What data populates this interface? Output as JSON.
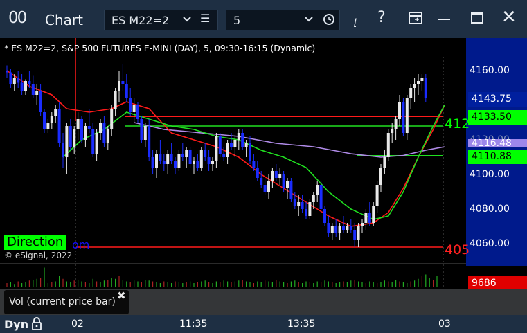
{
  "app": {
    "icon": "00",
    "title": "Chart"
  },
  "toolbar": {
    "symbol": "ES M22=2",
    "interval": "5",
    "icons": [
      "chevron-down-icon",
      "menu-icon",
      "clock-icon",
      "draw-icon",
      "help-icon",
      "export-icon",
      "restore-icon",
      "maximize-icon",
      "close-icon"
    ]
  },
  "chart": {
    "header": "* ES M22=2, S&P 500 FUTURES E-MINI (DAY), 5, 09:30-16:15 (Dynamic)",
    "direction_label": "Direction",
    "direction_tail": "om",
    "copyright": "© eSignal, 2022",
    "green_level_label": "412",
    "red_level_label": "405"
  },
  "price_axis": {
    "ticks": [
      "4160.00",
      "4120.00",
      "4100.00",
      "4080.00",
      "4060.00"
    ],
    "badges": {
      "last": "4143.75",
      "green_upper": "4133.50",
      "purple": "4116.48",
      "green_lower": "4110.88",
      "volume": "9686"
    }
  },
  "volume_panel": {
    "study_label": "Vol (current price bar)"
  },
  "time_axis": {
    "mode": "Dyn",
    "labels": [
      "02",
      "11:35",
      "13:35",
      "03"
    ]
  },
  "colors": {
    "bull": "#e8e8e8",
    "bear": "#1a2cff",
    "red_ma": "#ff1a1a",
    "green_ma": "#20e020",
    "purple_ma": "#b08be8",
    "price_axis_bg": "#001a8c",
    "badge_last": "#001f9e",
    "badge_green": "#00ff00",
    "badge_purple": "#9d87ea",
    "badge_volume": "#e00000"
  },
  "chart_data": {
    "type": "candlestick",
    "y_ticks": [
      4160,
      4140,
      4120,
      4100,
      4080,
      4060
    ],
    "candles": [
      {
        "o": 4160,
        "h": 4163,
        "l": 4156,
        "c": 4159
      },
      {
        "o": 4159,
        "h": 4161,
        "l": 4150,
        "c": 4152
      },
      {
        "o": 4152,
        "h": 4158,
        "l": 4148,
        "c": 4156
      },
      {
        "o": 4156,
        "h": 4160,
        "l": 4150,
        "c": 4153
      },
      {
        "o": 4153,
        "h": 4158,
        "l": 4146,
        "c": 4148
      },
      {
        "o": 4148,
        "h": 4155,
        "l": 4146,
        "c": 4154
      },
      {
        "o": 4154,
        "h": 4160,
        "l": 4150,
        "c": 4152
      },
      {
        "o": 4152,
        "h": 4157,
        "l": 4144,
        "c": 4146
      },
      {
        "o": 4146,
        "h": 4152,
        "l": 4140,
        "c": 4148
      },
      {
        "o": 4148,
        "h": 4152,
        "l": 4134,
        "c": 4136
      },
      {
        "o": 4136,
        "h": 4138,
        "l": 4124,
        "c": 4126
      },
      {
        "o": 4126,
        "h": 4132,
        "l": 4124,
        "c": 4130
      },
      {
        "o": 4130,
        "h": 4136,
        "l": 4126,
        "c": 4134
      },
      {
        "o": 4134,
        "h": 4140,
        "l": 4130,
        "c": 4138
      },
      {
        "o": 4138,
        "h": 4142,
        "l": 4116,
        "c": 4118
      },
      {
        "o": 4118,
        "h": 4124,
        "l": 4104,
        "c": 4110
      },
      {
        "o": 4110,
        "h": 4130,
        "l": 4100,
        "c": 4128
      },
      {
        "o": 4128,
        "h": 4132,
        "l": 4114,
        "c": 4116
      },
      {
        "o": 4116,
        "h": 4128,
        "l": 4112,
        "c": 4126
      },
      {
        "o": 4126,
        "h": 4136,
        "l": 4120,
        "c": 4132
      },
      {
        "o": 4132,
        "h": 4134,
        "l": 4118,
        "c": 4120
      },
      {
        "o": 4120,
        "h": 4130,
        "l": 4116,
        "c": 4128
      },
      {
        "o": 4128,
        "h": 4138,
        "l": 4124,
        "c": 4126
      },
      {
        "o": 4126,
        "h": 4130,
        "l": 4110,
        "c": 4112
      },
      {
        "o": 4112,
        "h": 4126,
        "l": 4108,
        "c": 4124
      },
      {
        "o": 4124,
        "h": 4132,
        "l": 4120,
        "c": 4130
      },
      {
        "o": 4130,
        "h": 4134,
        "l": 4116,
        "c": 4118
      },
      {
        "o": 4118,
        "h": 4128,
        "l": 4114,
        "c": 4126
      },
      {
        "o": 4126,
        "h": 4140,
        "l": 4122,
        "c": 4138
      },
      {
        "o": 4138,
        "h": 4150,
        "l": 4134,
        "c": 4148
      },
      {
        "o": 4148,
        "h": 4160,
        "l": 4142,
        "c": 4154
      },
      {
        "o": 4154,
        "h": 4164,
        "l": 4148,
        "c": 4152
      },
      {
        "o": 4152,
        "h": 4158,
        "l": 4142,
        "c": 4144
      },
      {
        "o": 4144,
        "h": 4150,
        "l": 4134,
        "c": 4136
      },
      {
        "o": 4136,
        "h": 4144,
        "l": 4130,
        "c": 4140
      },
      {
        "o": 4140,
        "h": 4142,
        "l": 4130,
        "c": 4132
      },
      {
        "o": 4132,
        "h": 4134,
        "l": 4118,
        "c": 4120
      },
      {
        "o": 4120,
        "h": 4130,
        "l": 4116,
        "c": 4128
      },
      {
        "o": 4128,
        "h": 4132,
        "l": 4108,
        "c": 4110
      },
      {
        "o": 4110,
        "h": 4114,
        "l": 4100,
        "c": 4104
      },
      {
        "o": 4104,
        "h": 4114,
        "l": 4098,
        "c": 4112
      },
      {
        "o": 4112,
        "h": 4120,
        "l": 4106,
        "c": 4108
      },
      {
        "o": 4108,
        "h": 4112,
        "l": 4102,
        "c": 4106
      },
      {
        "o": 4106,
        "h": 4114,
        "l": 4100,
        "c": 4112
      },
      {
        "o": 4112,
        "h": 4118,
        "l": 4106,
        "c": 4108
      },
      {
        "o": 4108,
        "h": 4110,
        "l": 4100,
        "c": 4104
      },
      {
        "o": 4104,
        "h": 4114,
        "l": 4102,
        "c": 4112
      },
      {
        "o": 4112,
        "h": 4118,
        "l": 4108,
        "c": 4110
      },
      {
        "o": 4110,
        "h": 4116,
        "l": 4104,
        "c": 4114
      },
      {
        "o": 4114,
        "h": 4116,
        "l": 4104,
        "c": 4106
      },
      {
        "o": 4106,
        "h": 4110,
        "l": 4100,
        "c": 4108
      },
      {
        "o": 4108,
        "h": 4112,
        "l": 4102,
        "c": 4104
      },
      {
        "o": 4104,
        "h": 4116,
        "l": 4102,
        "c": 4114
      },
      {
        "o": 4114,
        "h": 4118,
        "l": 4108,
        "c": 4110
      },
      {
        "o": 4110,
        "h": 4114,
        "l": 4102,
        "c": 4106
      },
      {
        "o": 4106,
        "h": 4110,
        "l": 4102,
        "c": 4108
      },
      {
        "o": 4108,
        "h": 4124,
        "l": 4104,
        "c": 4122
      },
      {
        "o": 4122,
        "h": 4124,
        "l": 4110,
        "c": 4112
      },
      {
        "o": 4112,
        "h": 4116,
        "l": 4108,
        "c": 4110
      },
      {
        "o": 4110,
        "h": 4120,
        "l": 4106,
        "c": 4118
      },
      {
        "o": 4118,
        "h": 4124,
        "l": 4114,
        "c": 4116
      },
      {
        "o": 4116,
        "h": 4122,
        "l": 4110,
        "c": 4120
      },
      {
        "o": 4120,
        "h": 4126,
        "l": 4114,
        "c": 4124
      },
      {
        "o": 4124,
        "h": 4126,
        "l": 4114,
        "c": 4116
      },
      {
        "o": 4116,
        "h": 4120,
        "l": 4110,
        "c": 4118
      },
      {
        "o": 4118,
        "h": 4122,
        "l": 4106,
        "c": 4108
      },
      {
        "o": 4108,
        "h": 4112,
        "l": 4102,
        "c": 4104
      },
      {
        "o": 4104,
        "h": 4108,
        "l": 4096,
        "c": 4098
      },
      {
        "o": 4098,
        "h": 4102,
        "l": 4092,
        "c": 4094
      },
      {
        "o": 4094,
        "h": 4098,
        "l": 4088,
        "c": 4090
      },
      {
        "o": 4090,
        "h": 4100,
        "l": 4086,
        "c": 4096
      },
      {
        "o": 4096,
        "h": 4104,
        "l": 4092,
        "c": 4102
      },
      {
        "o": 4102,
        "h": 4106,
        "l": 4096,
        "c": 4098
      },
      {
        "o": 4098,
        "h": 4104,
        "l": 4094,
        "c": 4100
      },
      {
        "o": 4100,
        "h": 4102,
        "l": 4090,
        "c": 4092
      },
      {
        "o": 4092,
        "h": 4098,
        "l": 4086,
        "c": 4096
      },
      {
        "o": 4096,
        "h": 4098,
        "l": 4084,
        "c": 4086
      },
      {
        "o": 4086,
        "h": 4090,
        "l": 4080,
        "c": 4082
      },
      {
        "o": 4082,
        "h": 4088,
        "l": 4076,
        "c": 4084
      },
      {
        "o": 4084,
        "h": 4088,
        "l": 4078,
        "c": 4080
      },
      {
        "o": 4080,
        "h": 4084,
        "l": 4074,
        "c": 4076
      },
      {
        "o": 4076,
        "h": 4086,
        "l": 4074,
        "c": 4084
      },
      {
        "o": 4084,
        "h": 4090,
        "l": 4080,
        "c": 4088
      },
      {
        "o": 4088,
        "h": 4096,
        "l": 4084,
        "c": 4094
      },
      {
        "o": 4094,
        "h": 4096,
        "l": 4078,
        "c": 4080
      },
      {
        "o": 4080,
        "h": 4082,
        "l": 4070,
        "c": 4072
      },
      {
        "o": 4072,
        "h": 4076,
        "l": 4064,
        "c": 4066
      },
      {
        "o": 4066,
        "h": 4072,
        "l": 4062,
        "c": 4070
      },
      {
        "o": 4070,
        "h": 4074,
        "l": 4064,
        "c": 4066
      },
      {
        "o": 4066,
        "h": 4072,
        "l": 4062,
        "c": 4070
      },
      {
        "o": 4070,
        "h": 4076,
        "l": 4066,
        "c": 4068
      },
      {
        "o": 4068,
        "h": 4072,
        "l": 4066,
        "c": 4070
      },
      {
        "o": 4070,
        "h": 4074,
        "l": 4066,
        "c": 4068
      },
      {
        "o": 4068,
        "h": 4072,
        "l": 4058,
        "c": 4062
      },
      {
        "o": 4062,
        "h": 4072,
        "l": 4058,
        "c": 4070
      },
      {
        "o": 4070,
        "h": 4074,
        "l": 4066,
        "c": 4072
      },
      {
        "o": 4072,
        "h": 4080,
        "l": 4068,
        "c": 4078
      },
      {
        "o": 4078,
        "h": 4084,
        "l": 4070,
        "c": 4072
      },
      {
        "o": 4072,
        "h": 4084,
        "l": 4070,
        "c": 4082
      },
      {
        "o": 4082,
        "h": 4096,
        "l": 4078,
        "c": 4094
      },
      {
        "o": 4094,
        "h": 4106,
        "l": 4090,
        "c": 4104
      },
      {
        "o": 4104,
        "h": 4114,
        "l": 4100,
        "c": 4110
      },
      {
        "o": 4110,
        "h": 4126,
        "l": 4108,
        "c": 4124
      },
      {
        "o": 4124,
        "h": 4130,
        "l": 4118,
        "c": 4126
      },
      {
        "o": 4126,
        "h": 4134,
        "l": 4120,
        "c": 4132
      },
      {
        "o": 4132,
        "h": 4146,
        "l": 4128,
        "c": 4142
      },
      {
        "o": 4142,
        "h": 4144,
        "l": 4122,
        "c": 4124
      },
      {
        "o": 4124,
        "h": 4146,
        "l": 4120,
        "c": 4144
      },
      {
        "o": 4144,
        "h": 4152,
        "l": 4138,
        "c": 4150
      },
      {
        "o": 4150,
        "h": 4156,
        "l": 4142,
        "c": 4152
      },
      {
        "o": 4152,
        "h": 4158,
        "l": 4146,
        "c": 4154
      },
      {
        "o": 4154,
        "h": 4158,
        "l": 4148,
        "c": 4156
      },
      {
        "o": 4156,
        "h": 4158,
        "l": 4142,
        "c": 4144
      }
    ],
    "red_ma": [
      [
        0,
        4160
      ],
      [
        6,
        4151
      ],
      [
        12,
        4146
      ],
      [
        16,
        4138
      ],
      [
        22,
        4136
      ],
      [
        28,
        4138
      ],
      [
        32,
        4142
      ],
      [
        38,
        4138
      ],
      [
        44,
        4124
      ],
      [
        50,
        4120
      ],
      [
        56,
        4116
      ],
      [
        62,
        4110
      ],
      [
        68,
        4100
      ],
      [
        74,
        4092
      ],
      [
        80,
        4084
      ],
      [
        86,
        4076
      ],
      [
        92,
        4070
      ],
      [
        98,
        4072
      ],
      [
        102,
        4078
      ],
      [
        106,
        4092
      ],
      [
        110,
        4110
      ],
      [
        114,
        4126
      ],
      [
        117,
        4140
      ]
    ],
    "green_ma": [
      [
        15,
        4110
      ],
      [
        20,
        4120
      ],
      [
        26,
        4126
      ],
      [
        32,
        4136
      ],
      [
        38,
        4132
      ],
      [
        44,
        4128
      ],
      [
        50,
        4126
      ],
      [
        56,
        4122
      ],
      [
        62,
        4120
      ],
      [
        68,
        4114
      ],
      [
        74,
        4110
      ],
      [
        80,
        4104
      ],
      [
        86,
        4090
      ],
      [
        92,
        4080
      ],
      [
        98,
        4074
      ],
      [
        102,
        4076
      ],
      [
        106,
        4090
      ],
      [
        110,
        4110
      ],
      [
        114,
        4128
      ],
      [
        117,
        4140
      ]
    ],
    "purple_ma": [
      [
        34,
        4130
      ],
      [
        42,
        4126
      ],
      [
        52,
        4124
      ],
      [
        62,
        4122
      ],
      [
        72,
        4118
      ],
      [
        82,
        4116
      ],
      [
        92,
        4112
      ],
      [
        100,
        4110
      ],
      [
        106,
        4111
      ],
      [
        112,
        4114
      ],
      [
        117,
        4116
      ]
    ],
    "levels": {
      "green_upper": 4133.5,
      "green_mid": 4128,
      "green_lower": 4110.88,
      "red_upper": 4133.5,
      "red_lower": 4058
    },
    "volume": [
      4,
      5,
      3,
      6,
      4,
      5,
      7,
      8,
      9,
      10,
      22,
      4,
      5,
      6,
      12,
      9,
      6,
      5,
      7,
      8,
      6,
      5,
      4,
      9,
      6,
      5,
      7,
      8,
      10,
      9,
      12,
      8,
      6,
      5,
      7,
      6,
      5,
      8,
      7,
      6,
      5,
      4,
      6,
      5,
      4,
      6,
      5,
      4,
      5,
      6,
      4,
      5,
      6,
      7,
      5,
      4,
      6,
      5,
      7,
      6,
      5,
      6,
      7,
      8,
      6,
      5,
      4,
      6,
      5,
      7,
      6,
      5,
      8,
      6,
      5,
      4,
      6,
      7,
      5,
      4,
      6,
      5,
      4,
      6,
      5,
      7,
      6,
      5,
      4,
      5,
      6,
      5,
      7,
      8,
      6,
      5,
      4,
      6,
      5,
      4,
      5,
      7,
      6,
      5,
      8,
      6,
      5,
      4,
      6,
      7,
      9,
      12,
      14,
      10,
      8,
      12
    ],
    "volume_last": 9686
  }
}
